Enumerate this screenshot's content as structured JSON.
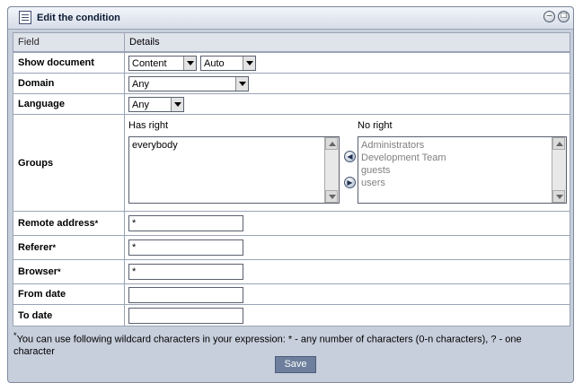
{
  "title": "Edit the condition",
  "header": {
    "field": "Field",
    "details": "Details"
  },
  "rows": {
    "show_document": {
      "label": "Show document",
      "select1": "Content",
      "select2": "Auto"
    },
    "domain": {
      "label": "Domain",
      "select": "Any"
    },
    "language": {
      "label": "Language",
      "select": "Any"
    },
    "groups": {
      "label": "Groups",
      "has_right_label": "Has right",
      "no_right_label": "No right",
      "has_right": [
        "everybody"
      ],
      "no_right": [
        "Administrators",
        "Development Team",
        "guests",
        "users"
      ]
    },
    "remote_address": {
      "label": "Remote address",
      "star": "*",
      "value": "*"
    },
    "referer": {
      "label": "Referer",
      "star": "*",
      "value": "*"
    },
    "browser": {
      "label": "Browser",
      "star": "*",
      "value": "*"
    },
    "from_date": {
      "label": "From date",
      "value": ""
    },
    "to_date": {
      "label": "To date",
      "value": ""
    }
  },
  "note_star": "*",
  "note": "You can use following wildcard characters in your expression: * - any number of characters (0-n characters), ? - one character",
  "save": "Save"
}
